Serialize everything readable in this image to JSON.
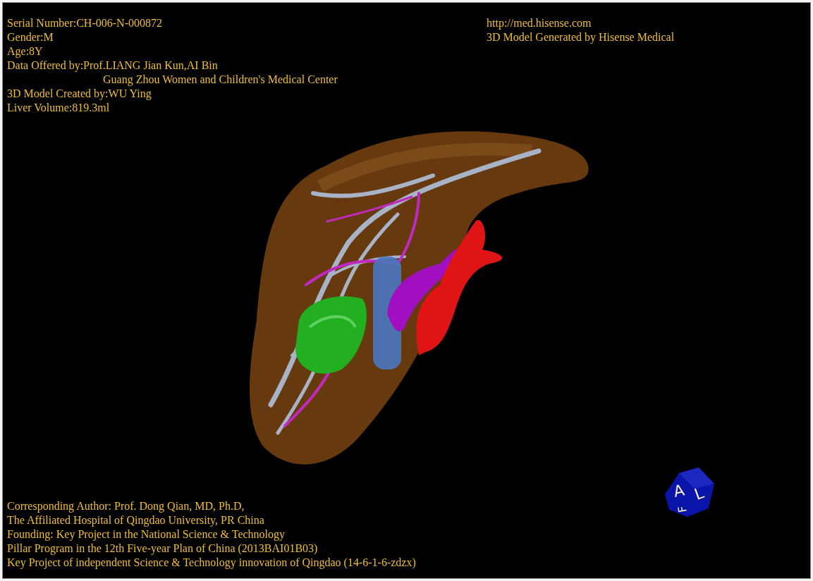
{
  "patient_info": [
    {
      "text": "Serial Number:CH-006-N-000872"
    },
    {
      "text": "Gender:M"
    },
    {
      "text": "Age:8Y"
    },
    {
      "text": "Data Offered by:Prof.LIANG Jian Kun,AI Bin",
      "continuation": "Guang Zhou Women and Children's Medical Center"
    },
    {
      "text": "3D Model Created by:WU Ying"
    },
    {
      "text": "Liver Volume:819.3ml"
    }
  ],
  "credits": [
    "http://med.hisense.com",
    "3D Model Generated by Hisense Medical"
  ],
  "footer": [
    "Corresponding Author: Prof. Dong Qian, MD, Ph.D,",
    "The Affiliated Hospital of Qingdao University, PR China",
    "Founding: Key Project in the National Science & Technology",
    "Pillar Program in the 12th Five-year Plan of China (2013BAI01B03)",
    "Key Project of independent Science & Technology innovation of Qingdao (14-6-1-6-zdzx)"
  ],
  "orientation_cube": {
    "faces": [
      "A",
      "L",
      "F"
    ]
  }
}
